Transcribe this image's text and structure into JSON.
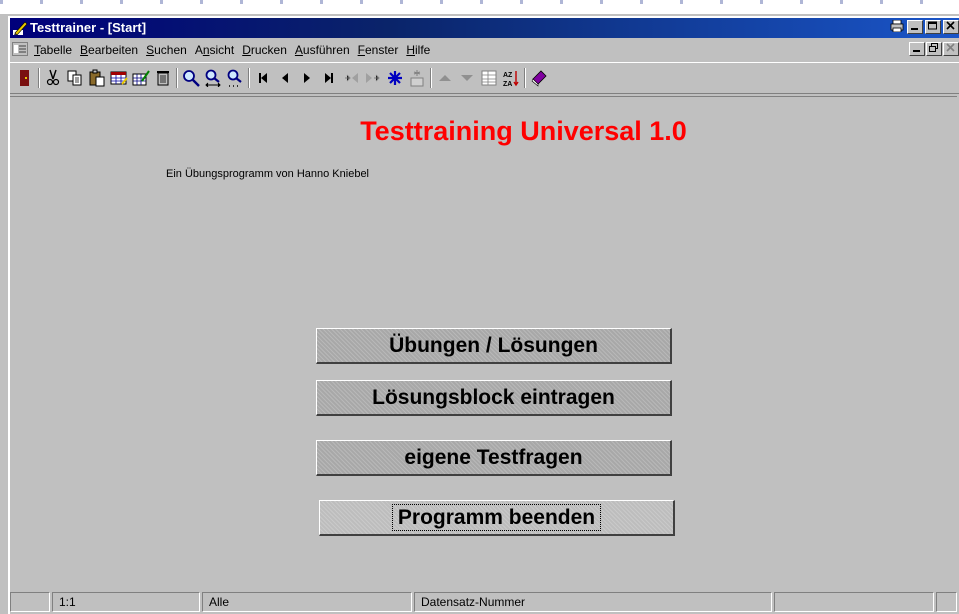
{
  "window": {
    "title": "Testtrainer - [Start]",
    "title_bar_buttons": [
      "print-icon",
      "minimize-icon",
      "maximize-icon",
      "close-icon"
    ],
    "mdi_buttons": [
      "minimize-icon",
      "restore-icon",
      "close-icon"
    ],
    "title_gradient": [
      "#00007b",
      "#1a55c8"
    ]
  },
  "menubar": {
    "items": [
      {
        "accel": "T",
        "rest": "abelle"
      },
      {
        "accel": "B",
        "rest": "earbeiten"
      },
      {
        "accel": "S",
        "rest": "uchen"
      },
      {
        "pre": "A",
        "accel": "n",
        "rest": "sicht"
      },
      {
        "accel": "D",
        "rest": "rucken"
      },
      {
        "accel": "A",
        "rest": "usführen"
      },
      {
        "accel": "F",
        "rest": "enster"
      },
      {
        "accel": "H",
        "rest": "ilfe"
      }
    ]
  },
  "toolbar": {
    "icons": [
      "exit-door-icon",
      "cut-icon",
      "copy-icon",
      "paste-icon",
      "edit-table-icon",
      "edit-record-icon",
      "delete-icon",
      "find-icon",
      "find-replace-icon",
      "find-next-icon",
      "first-record-icon",
      "previous-record-icon",
      "next-record-icon",
      "last-record-icon",
      "insert-before-icon",
      "insert-after-icon",
      "new-record-icon",
      "filter-icon",
      "sort-up-icon",
      "sort-down-icon",
      "form-view-icon",
      "sort-az-icon",
      "help-book-icon"
    ]
  },
  "main": {
    "title": "Testtraining Universal 1.0",
    "subtitle": "Ein Übungsprogramm von Hanno Kniebel",
    "title_color": "#ff0000",
    "buttons": {
      "exercises": "Übungen / Lösungen",
      "solution_block": "Lösungsblock eintragen",
      "own_questions": "eigene Testfragen",
      "quit": "Programm beenden"
    }
  },
  "statusbar": {
    "position": "1:1",
    "filter": "Alle",
    "record_label": "Datensatz-Nummer"
  }
}
